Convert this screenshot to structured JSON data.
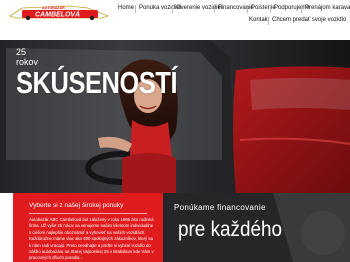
{
  "brand": {
    "logo_top": "AUTOBAZÁR",
    "logo_name": "CAMBELOVÁ",
    "colors": {
      "red": "#e01b1e",
      "dark": "#222222",
      "white": "#ffffff"
    }
  },
  "nav": {
    "items": [
      "Home",
      "Ponuka vozidiel",
      "Overenie vozidiel",
      "Financovanie",
      "Poistenie",
      "Podporujeme",
      "Prenájom karavanov",
      "Kontakt",
      "Chcem predať svoje vozidlo"
    ]
  },
  "hero": {
    "years_number": "25",
    "years_label": "rokov",
    "headline": "SKÚSENOSTÍ"
  },
  "offer": {
    "title": "Vyberte si z našej širokej ponuky",
    "body": "Autobazár ABC Cambelová bol založený v roku 1995 ako rodinná firma. Už vyše 25 rokov sa venujeme našim klientom individuálne s cieľom najlepšie oboznámiť a vyhovieť na našich vozidlách. Každoročne máme viac ako 600 spokojných zákazníkov, ktorý sa k nám radi vracajú. Preto neváhajte a príďte si vybrať vozidlo do nášho autobazáru na Starej Vajnorskej 25 v Bratislave kde Vám v pracovných dňoch poradia..."
  },
  "finance": {
    "subtitle": "Ponúkame financovanie",
    "headline": "pre každého"
  }
}
